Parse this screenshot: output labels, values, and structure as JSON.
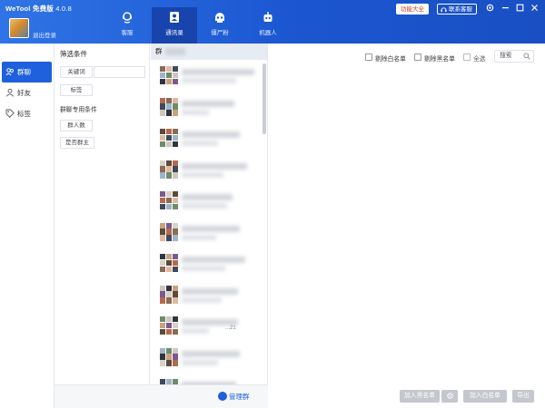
{
  "app": {
    "name": "WeTool 免费版",
    "version": "4.0.8"
  },
  "profile": {
    "logout_label": "退出登录"
  },
  "nav_tabs": [
    {
      "label": "客服",
      "icon": "customer-service-icon"
    },
    {
      "label": "通讯录",
      "icon": "contacts-icon"
    },
    {
      "label": "僵尸粉",
      "icon": "zombie-icon"
    },
    {
      "label": "机器人",
      "icon": "robot-icon"
    }
  ],
  "active_tab": "通讯录",
  "toolbar": {
    "features_label": "功能大全",
    "contact_label": "联系客服"
  },
  "sidebar": {
    "items": [
      {
        "label": "群聊",
        "icon": "group-icon"
      },
      {
        "label": "好友",
        "icon": "friend-icon"
      },
      {
        "label": "标签",
        "icon": "tag-icon"
      }
    ],
    "active": "群聊"
  },
  "filter": {
    "title": "筛选条件",
    "keyword_label": "关键词",
    "tag_label": "标签",
    "group_section_title": "群聊专用条件",
    "member_count_label": "群人数",
    "is_owner_label": "是否群主",
    "manage_label": "管理群"
  },
  "group_list": {
    "header_prefix": "群",
    "visible_fragment": "...21"
  },
  "right": {
    "delete_whitelist_label": "剔除白名单",
    "delete_blacklist_label": "剔除黑名单",
    "select_all_label": "全选",
    "search_placeholder": "搜索",
    "add_blacklist_label": "加入黑名单",
    "add_whitelist_label": "加入白名单",
    "export_label": "导出"
  },
  "colors": {
    "brand": "#1f60dc",
    "topbar": "#1b56d0",
    "disabled_button": "#c4c7cd"
  }
}
